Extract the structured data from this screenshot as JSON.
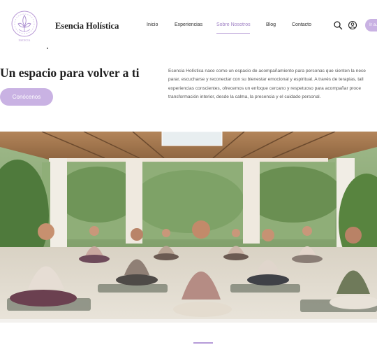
{
  "brand": {
    "name": "Esencia Holística",
    "logo_icon": "lotus-logo-icon",
    "accent": "#9f80c4"
  },
  "nav": {
    "items": [
      {
        "label": "Inicio",
        "active": false
      },
      {
        "label": "Experiencias",
        "active": false
      },
      {
        "label": "Sobre Nosotros",
        "active": true
      },
      {
        "label": "Blog",
        "active": false
      },
      {
        "label": "Contacto",
        "active": false
      }
    ],
    "icons": [
      "search-icon",
      "user-icon"
    ],
    "cta_label": "Ir a…"
  },
  "intro": {
    "title": "Un espacio para volver a ti",
    "button_label": "Conócenos",
    "paragraph_lines": [
      "Esencia Holística nace como un espacio de acompañamiento para personas que sienten la nece",
      "parar, escucharse y reconectar con su bienestar emocional y espiritual. A través de terapias, tall",
      "experiencias conscientes, ofrecemos un enfoque cercano y respetuoso para acompañar proce",
      "transformación interior, desde la calma, la presencia y el cuidado personal."
    ]
  },
  "hero": {
    "description_icon": "meditation-group-photo"
  }
}
